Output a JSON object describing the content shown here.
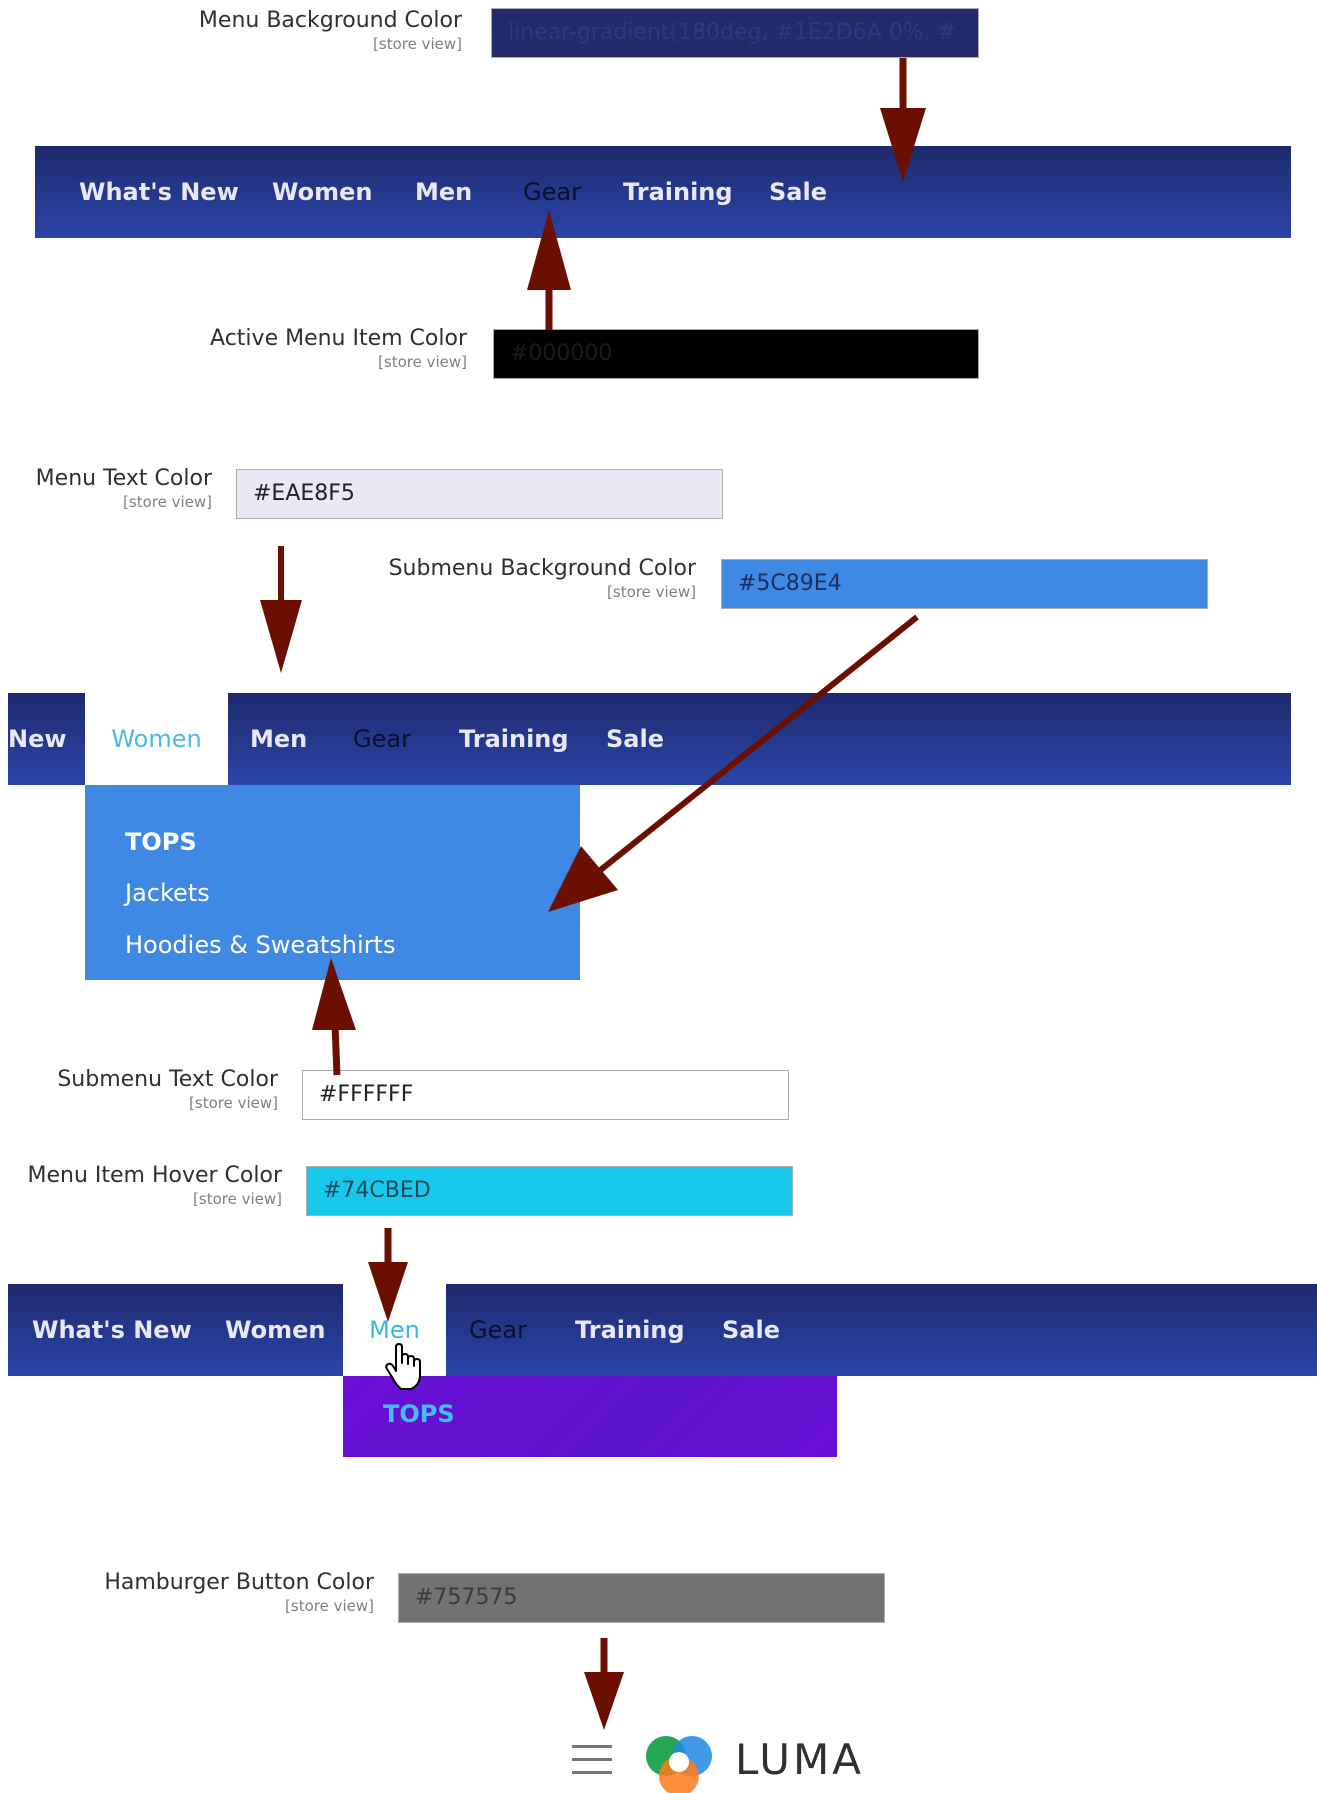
{
  "colors": {
    "menu_bg_start": "#1e2a6e",
    "menu_bg_end": "#2a45a8",
    "active_item": "#000000",
    "menu_text": "#EAE8F5",
    "submenu_bg": "#3f88e4",
    "submenu_text": "#FFFFFF",
    "hover": "#74CBED",
    "hamburger": "#757575",
    "arrow": "#6b1000",
    "purple_submenu": "#6a0fd6"
  },
  "fields": {
    "menu_bg": {
      "label": "Menu Background Color",
      "scope": "[store view]",
      "value": "linear-gradient(180deg, #1E2D6A 0%, #"
    },
    "active_item": {
      "label": "Active Menu Item Color",
      "scope": "[store view]",
      "value": "#000000"
    },
    "menu_text": {
      "label": "Menu Text Color",
      "scope": "[store view]",
      "value": "#EAE8F5"
    },
    "submenu_bg": {
      "label": "Submenu Background Color",
      "scope": "[store view]",
      "value": "#5C89E4"
    },
    "submenu_text": {
      "label": "Submenu Text Color",
      "scope": "[store view]",
      "value": "#FFFFFF"
    },
    "hover": {
      "label": "Menu Item Hover Color",
      "scope": "[store view]",
      "value": "#74CBED"
    },
    "hamburger": {
      "label": "Hamburger Button Color",
      "scope": "[store view]",
      "value": "#757575"
    }
  },
  "menu1": {
    "items": [
      "What's New",
      "Women",
      "Men",
      "Gear",
      "Training",
      "Sale"
    ]
  },
  "menu2": {
    "items": [
      "New",
      "Women",
      "Men",
      "Gear",
      "Training",
      "Sale"
    ],
    "submenu": [
      "TOPS",
      "Jackets",
      "Hoodies & Sweatshirts"
    ]
  },
  "menu3": {
    "items": [
      "What's New",
      "Women",
      "Men",
      "Gear",
      "Training",
      "Sale"
    ],
    "submenu": [
      "TOPS"
    ]
  },
  "logo": {
    "text": "LUMA"
  }
}
